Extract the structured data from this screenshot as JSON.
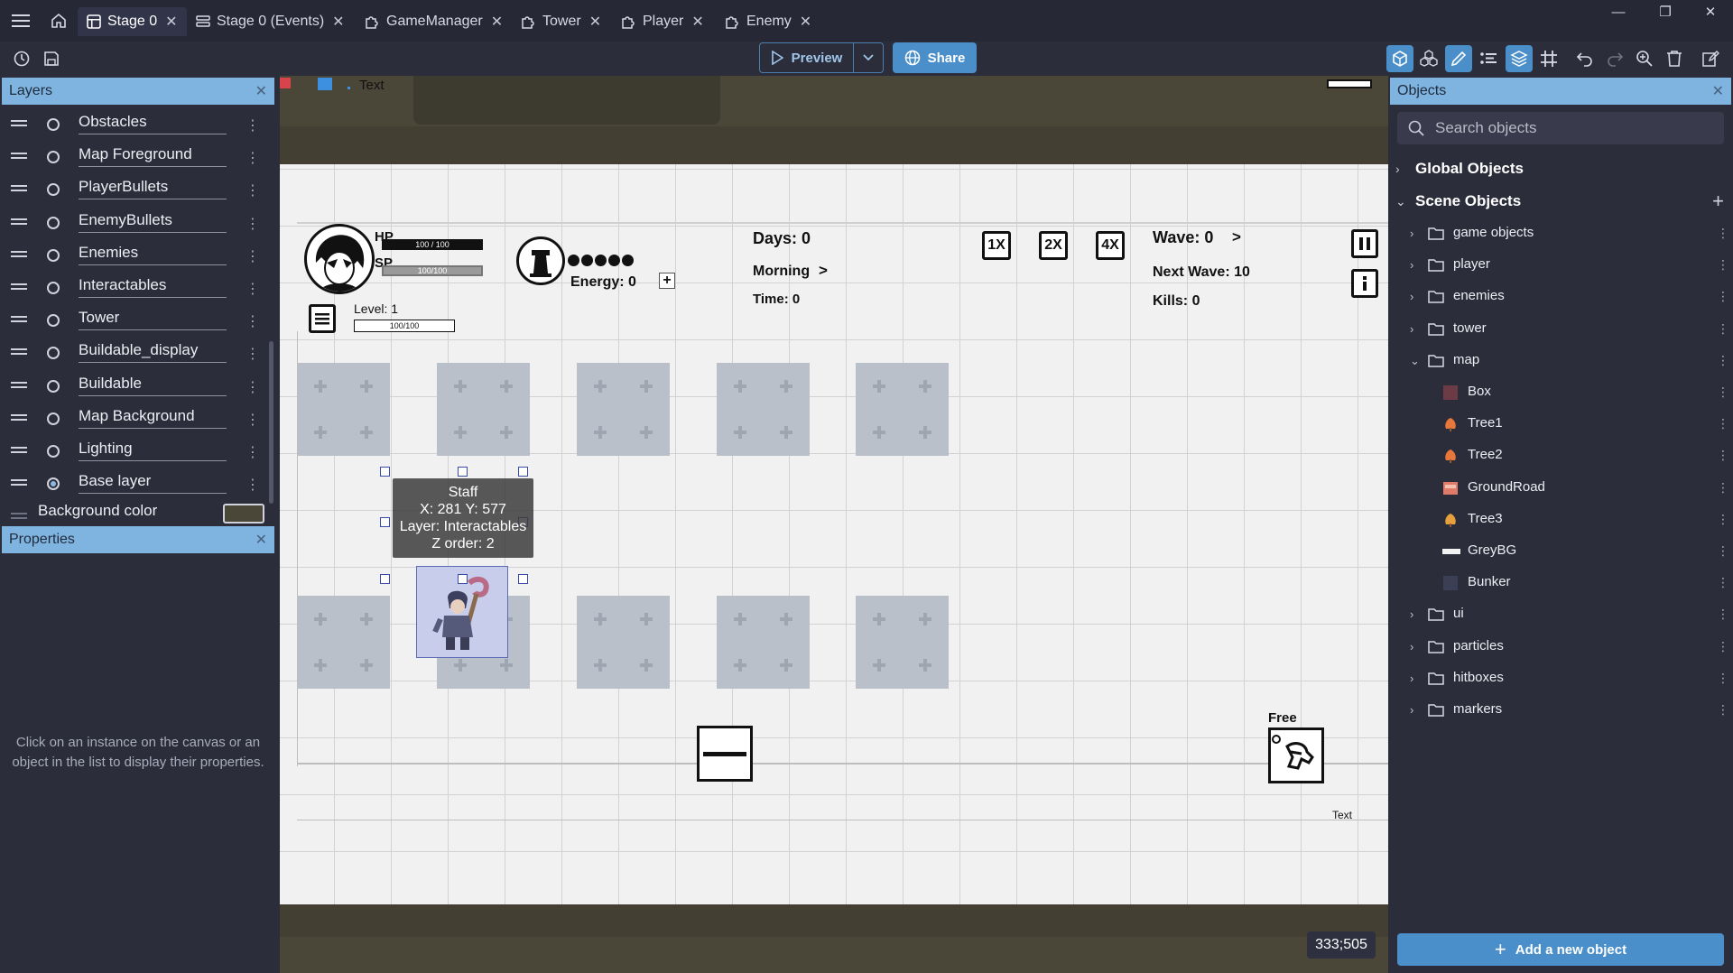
{
  "tabs": [
    {
      "label": "Stage 0",
      "active": true
    },
    {
      "label": "Stage 0 (Events)",
      "active": false
    },
    {
      "label": "GameManager",
      "active": false
    },
    {
      "label": "Tower",
      "active": false
    },
    {
      "label": "Player",
      "active": false
    },
    {
      "label": "Enemy",
      "active": false
    }
  ],
  "toolbar": {
    "preview_label": "Preview",
    "share_label": "Share"
  },
  "layers": {
    "title": "Layers",
    "items": [
      {
        "name": "Obstacles",
        "selected": false
      },
      {
        "name": "Map Foreground",
        "selected": false
      },
      {
        "name": "PlayerBullets",
        "selected": false
      },
      {
        "name": "EnemyBullets",
        "selected": false
      },
      {
        "name": "Enemies",
        "selected": false
      },
      {
        "name": "Interactables",
        "selected": false
      },
      {
        "name": "Tower",
        "selected": false
      },
      {
        "name": "Buildable_display",
        "selected": false
      },
      {
        "name": "Buildable",
        "selected": false
      },
      {
        "name": "Map Background",
        "selected": false
      },
      {
        "name": "Lighting",
        "selected": false
      },
      {
        "name": "Base layer",
        "selected": true
      }
    ],
    "background_color_label": "Background color",
    "background_color": "#4a4638"
  },
  "properties": {
    "title": "Properties",
    "hint": "Click on an instance on the canvas or an object in the list to display their properties."
  },
  "canvas": {
    "top_text": "Text",
    "hud": {
      "hp": "HP",
      "sp": "SP",
      "hp_value": "100 / 100",
      "sp_value": "100/100",
      "level": "Level: 1",
      "level_bar": "100/100",
      "energy": "Energy: 0",
      "days": "Days: 0",
      "morning": "Morning",
      "time": "Time: 0",
      "wave": "Wave: 0",
      "next_wave": "Next Wave: 10",
      "kills": "Kills: 0",
      "speed_1x": "1X",
      "speed_2x": "2X",
      "speed_4x": "4X",
      "free": "Free",
      "text_label": "Text"
    },
    "tooltip": {
      "name": "Staff",
      "position": "X: 281  Y: 577",
      "layer": "Layer: Interactables",
      "z_order": "Z order: 2"
    },
    "coords": "333;505"
  },
  "objects": {
    "title": "Objects",
    "search_placeholder": "Search objects",
    "global_label": "Global Objects",
    "scene_label": "Scene Objects",
    "folders_top": [
      "game objects",
      "player",
      "enemies",
      "tower"
    ],
    "map_folder": "map",
    "map_children": [
      {
        "name": "Box",
        "icon": "box-swatch",
        "color": "#6b3b46"
      },
      {
        "name": "Tree1",
        "icon": "tree-icon",
        "color": "#e8773c"
      },
      {
        "name": "Tree2",
        "icon": "tree-icon",
        "color": "#e8773c"
      },
      {
        "name": "GroundRoad",
        "icon": "road-tile-icon",
        "color": "#e07b6a"
      },
      {
        "name": "Tree3",
        "icon": "tree-icon",
        "color": "#e8a03c"
      },
      {
        "name": "GreyBG",
        "icon": "grey-bar-icon",
        "color": "#f2f2f2"
      },
      {
        "name": "Bunker",
        "icon": "bunker-icon",
        "color": "#3a3f56"
      }
    ],
    "folders_bottom": [
      "ui",
      "particles",
      "hitboxes",
      "markers"
    ],
    "add_label": "Add a new object"
  }
}
